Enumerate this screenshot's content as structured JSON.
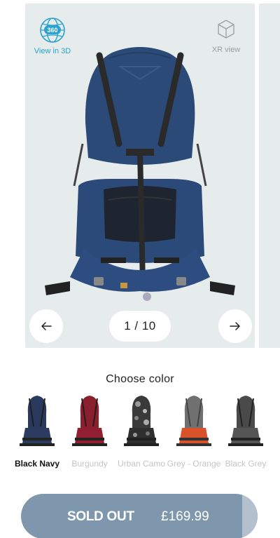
{
  "gallery": {
    "view_3d_label": "View in 3D",
    "view_3d_badge": "360",
    "xr_view_label": "XR view",
    "counter": "1 / 10",
    "colors": {
      "background": "#e6ebeb",
      "accent": "#2aa3cf"
    }
  },
  "color_picker": {
    "title": "Choose color",
    "options": [
      {
        "label": "Black Navy",
        "selected": true
      },
      {
        "label": "Burgundy",
        "selected": false
      },
      {
        "label": "Urban Camo",
        "selected": false
      },
      {
        "label": "Grey - Orange",
        "selected": false
      },
      {
        "label": "Black Grey",
        "selected": false
      }
    ]
  },
  "buy_bar": {
    "status": "SOLD OUT",
    "price": "£169.99",
    "color": "#7e97ad"
  }
}
